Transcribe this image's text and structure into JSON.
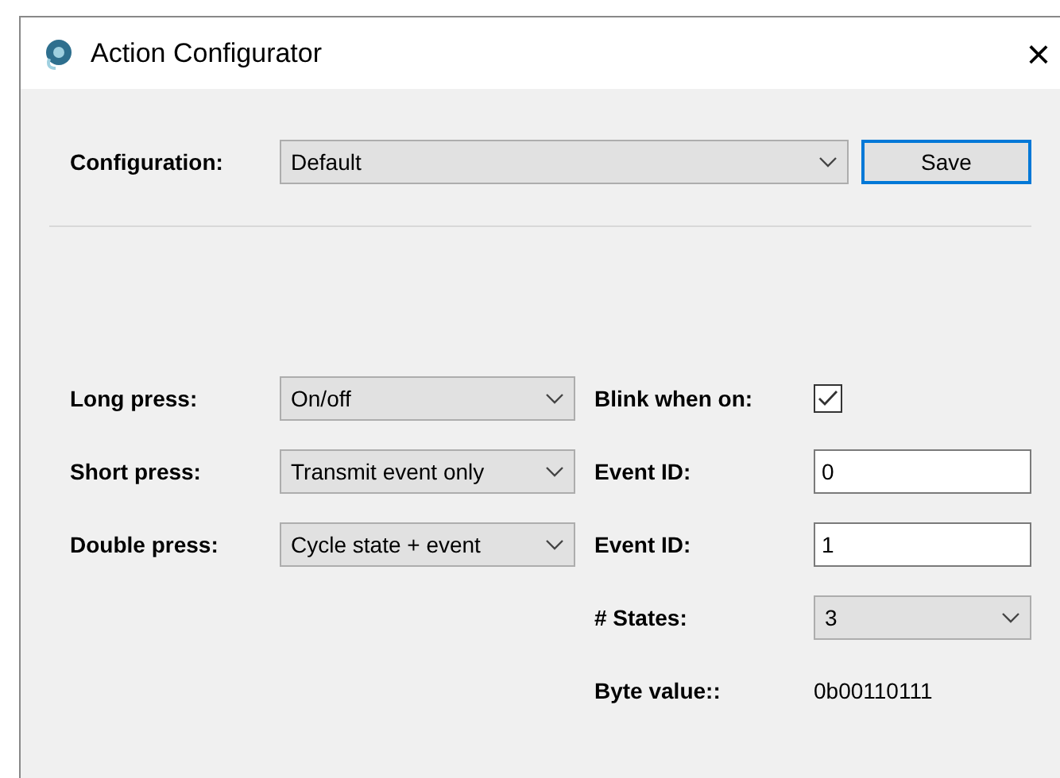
{
  "window": {
    "title": "Action Configurator",
    "close": "×"
  },
  "configuration": {
    "label": "Configuration:",
    "value": "Default",
    "save": "Save"
  },
  "left_rows": [
    {
      "label": "Long press:",
      "value": "On/off"
    },
    {
      "label": "Short press:",
      "value": "Transmit event only"
    },
    {
      "label": "Double press:",
      "value": "Cycle state + event"
    }
  ],
  "right_rows": [
    {
      "kind": "checkbox",
      "label": "Blink when on:",
      "checked": true
    },
    {
      "kind": "input",
      "label": "Event ID:",
      "value": "0"
    },
    {
      "kind": "input",
      "label": "Event ID:",
      "value": "1"
    },
    {
      "kind": "select",
      "label": "# States:",
      "value": "3"
    },
    {
      "kind": "text",
      "label": "Byte value::",
      "value": "0b00110111"
    }
  ]
}
